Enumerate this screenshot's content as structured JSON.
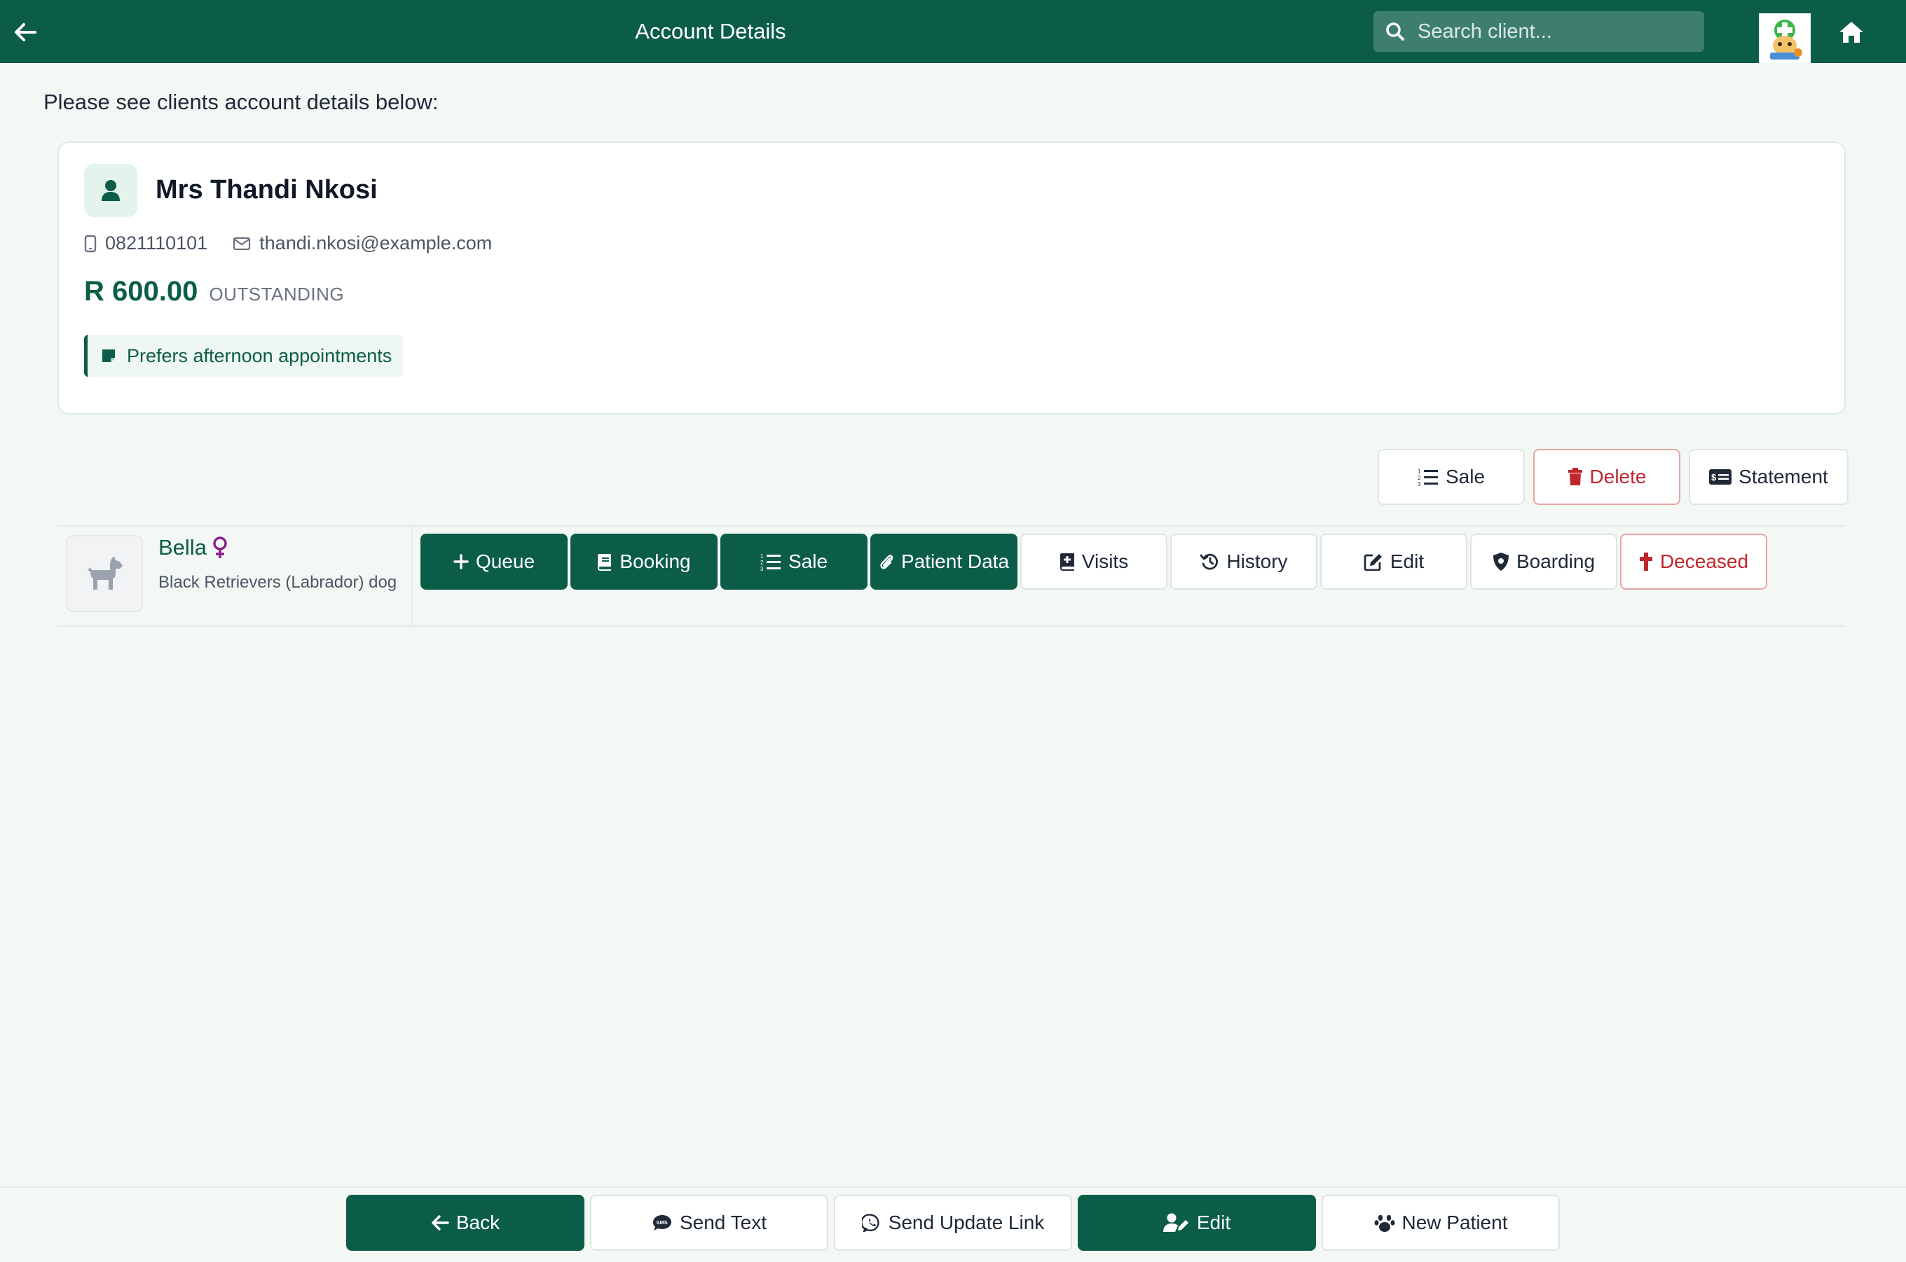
{
  "header": {
    "title": "Account Details",
    "search_placeholder": "Search client..."
  },
  "intro_text": "Please see clients account details below:",
  "client": {
    "name": "Mrs Thandi Nkosi",
    "phone": "0821110101",
    "email": "thandi.nkosi@example.com",
    "balance": "R 600.00",
    "balance_label": "OUTSTANDING",
    "note": "Prefers afternoon appointments"
  },
  "account_actions": {
    "sale": "Sale",
    "delete": "Delete",
    "statement": "Statement"
  },
  "patient": {
    "name": "Bella",
    "sex": "female",
    "breed": "Black Retrievers (Labrador) dog",
    "actions": {
      "queue": "Queue",
      "booking": "Booking",
      "sale": "Sale",
      "patient_data": "Patient Data",
      "visits": "Visits",
      "history": "History",
      "edit": "Edit",
      "boarding": "Boarding",
      "deceased": "Deceased"
    }
  },
  "footer": {
    "back": "Back",
    "send_text": "Send Text",
    "send_update_link": "Send Update Link",
    "edit": "Edit",
    "new_patient": "New Patient"
  },
  "colors": {
    "brand": "#0c5d48",
    "danger": "#c0262d",
    "background": "#f3f8f5"
  }
}
